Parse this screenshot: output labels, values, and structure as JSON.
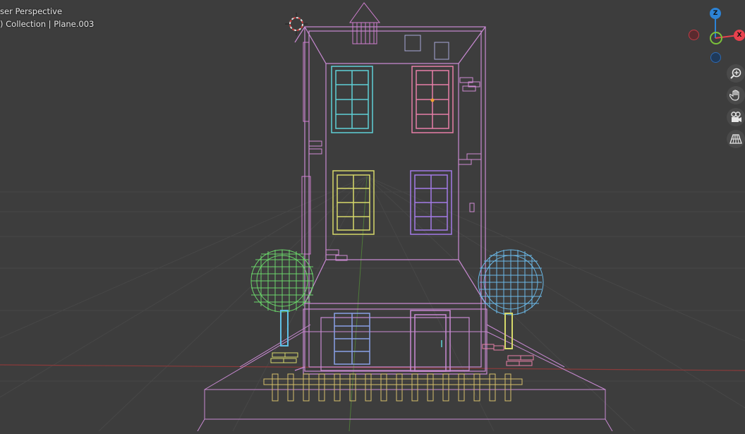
{
  "viewport": {
    "view_label": "ser Perspective",
    "collection_label": ") Collection | Plane.003"
  },
  "gizmo": {
    "z_label": "Z",
    "x_label": "X",
    "x_color": "#e8414d",
    "y_color": "#7bc23a",
    "z_color": "#2c83d6"
  },
  "nav_buttons": [
    {
      "icon": "zoom-icon"
    },
    {
      "icon": "hand-pan-icon"
    },
    {
      "icon": "camera-icon"
    },
    {
      "icon": "grid-perspective-icon"
    }
  ],
  "wire_colors": {
    "building": "#c98ad3",
    "window_cyan": "#5fd0d6",
    "window_pink": "#e77fa8",
    "window_yellow": "#d6d86a",
    "window_purple": "#a37be6",
    "tree_green": "#6ad46a",
    "tree_blue": "#6ab8e6",
    "grid": "#474747",
    "x_axis": "#8a3a3a"
  }
}
